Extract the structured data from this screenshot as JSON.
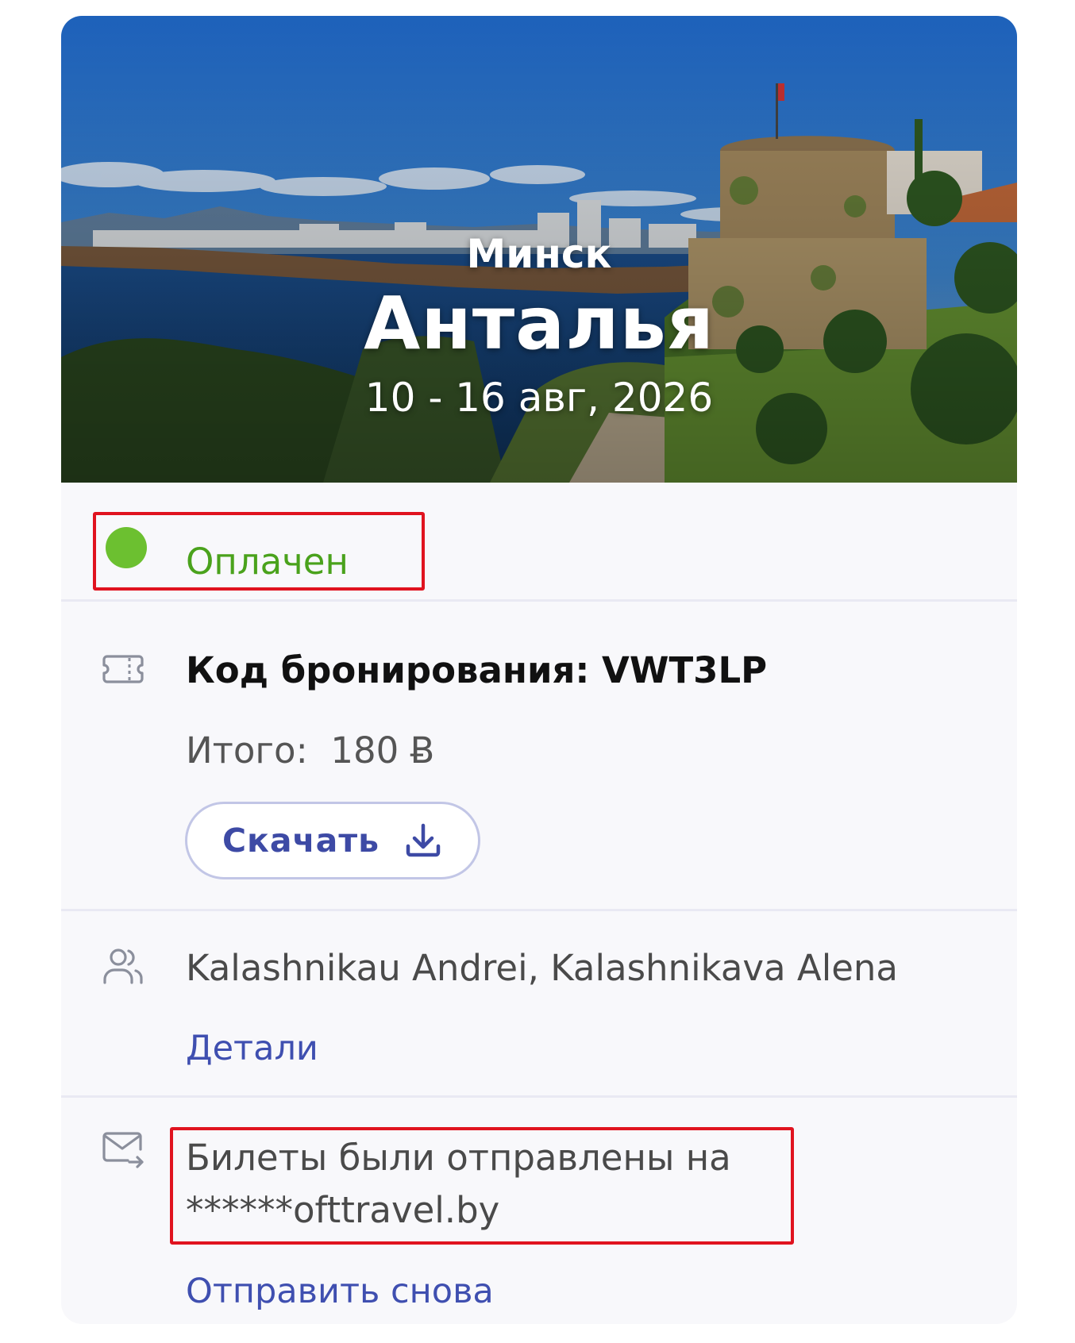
{
  "trip": {
    "origin": "Минск",
    "destination": "Анталья",
    "dates": "10 - 16 авг, 2026"
  },
  "status": {
    "label": "Оплачен",
    "color": "#4aa21c",
    "dot_color": "#6cc030"
  },
  "booking": {
    "code_text": "Код бронирования: VWT3LP",
    "total_text": "Итого:  180 Ƀ",
    "download_label": "Скачать"
  },
  "passengers": {
    "names": "Kalashnikau Andrei, Kalashnikava Alena",
    "details_link": "Детали"
  },
  "email": {
    "line1": "Билеты были отправлены на",
    "line2": "******ofttravel.by",
    "resend_link": "Отправить снова"
  },
  "icons": {
    "ticket": "ticket-icon",
    "passengers": "users-icon",
    "email": "mail-forward-icon",
    "download": "download-icon"
  },
  "colors": {
    "accent": "#3f4fb0",
    "highlight": "#e0131f"
  }
}
